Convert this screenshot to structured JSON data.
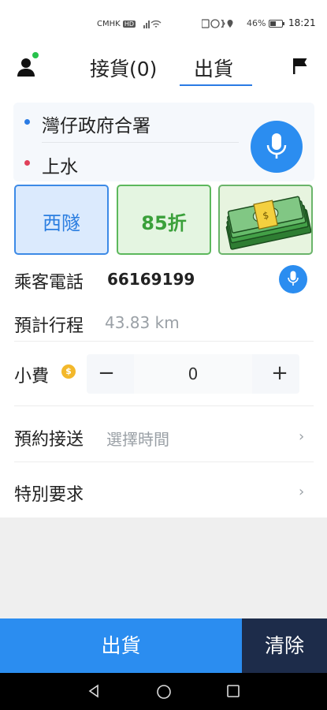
{
  "status_bar": {
    "carrier": "CMHK",
    "carrier_tag": "HD",
    "battery": "46%",
    "time": "18:21"
  },
  "tabs": {
    "receive": "接貨(0)",
    "ship": "出貨"
  },
  "route": {
    "from": "灣仔政府合署",
    "to": "上水",
    "from_dot_color": "#2a7be4",
    "to_dot_color": "#e0405a"
  },
  "options": {
    "tunnel": "西隧",
    "discount": "85折",
    "cash_icon": "cash-bundle-icon"
  },
  "phone": {
    "label": "乘客電話",
    "value": "66169199"
  },
  "trip": {
    "label": "預計行程",
    "value": "43.83 km"
  },
  "tip": {
    "label": "小費",
    "coin_symbol": "$",
    "minus": "−",
    "value": "0",
    "plus": "+"
  },
  "booking": {
    "label": "預約接送",
    "placeholder": "選擇時間",
    "chevron": "›"
  },
  "special": {
    "label": "特別要求",
    "chevron": "›"
  },
  "actions": {
    "ship": "出貨",
    "clear": "清除"
  },
  "colors": {
    "accent": "#2b8df0",
    "dark": "#1d2c4a",
    "online": "#27c24c"
  }
}
